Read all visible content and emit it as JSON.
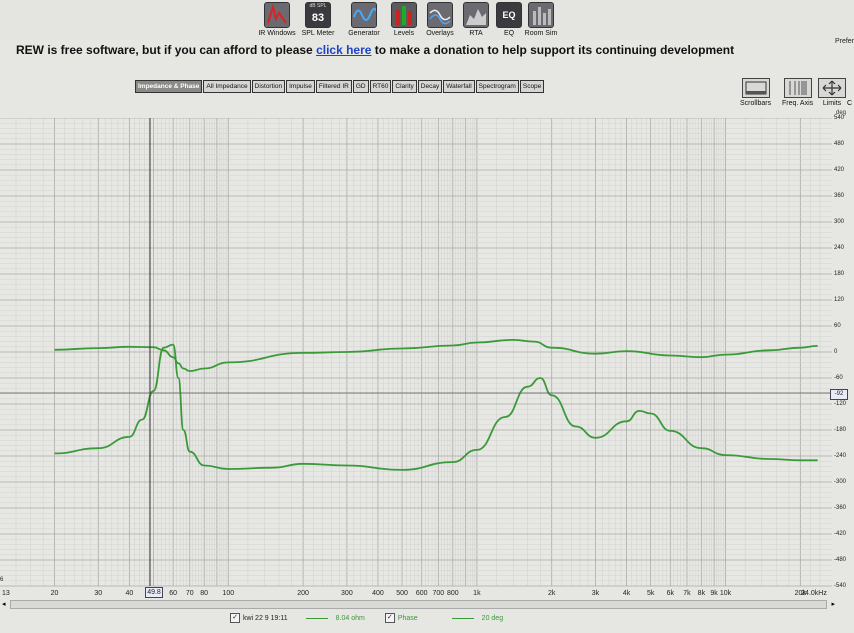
{
  "toolbar": {
    "tools": [
      {
        "label": "IR Windows",
        "icon": "ir-windows-icon"
      },
      {
        "label": "SPL Meter",
        "icon": "spl-meter-icon",
        "badge_top": "dB SPL",
        "badge_value": "83"
      },
      {
        "label": "Generator",
        "icon": "generator-icon"
      },
      {
        "label": "Levels",
        "icon": "levels-icon"
      },
      {
        "label": "Overlays",
        "icon": "overlays-icon"
      },
      {
        "label": "RTA",
        "icon": "rta-icon"
      },
      {
        "label": "EQ",
        "icon": "eq-icon",
        "badge_value": "EQ"
      },
      {
        "label": "Room Sim",
        "icon": "room-sim-icon"
      }
    ],
    "preferences_label": "Prefer"
  },
  "banner": {
    "before": "REW is free software, but if you can afford to please ",
    "link": "click here",
    "after": " to make a donation to help support its continuing development"
  },
  "tabs": [
    "Impedance & Phase",
    "All Impedance",
    "Distortion",
    "Impulse",
    "Filtered IR",
    "GD",
    "RT60",
    "Clarity",
    "Decay",
    "Waterfall",
    "Spectrogram",
    "Scope"
  ],
  "active_tab": "Impedance & Phase",
  "right_tools": {
    "scrollbars": "Scrollbars",
    "freq_axis": "Freq. Axis",
    "limits": "Limits",
    "extra": "C"
  },
  "y_unit": "deg",
  "cursor": {
    "x_readout": "49.8",
    "y_readout": "-92"
  },
  "x_axis_left_value": "13",
  "y_axis_left_fragments": [
    "6"
  ],
  "legend": {
    "name": "kwi 22 9 19:11",
    "impedance_value": "8.04 ohm",
    "phase_label": "Phase",
    "phase_value": "20 deg"
  },
  "colors": {
    "trace": "#3a9a3a",
    "grid": "#bdbdba",
    "background": "#e6e6e3",
    "link": "#1d43c6"
  },
  "chart_data": {
    "type": "line",
    "title": "",
    "xscale": "log",
    "xlim": [
      13,
      24000
    ],
    "ylim": [
      -540,
      540
    ],
    "y_unit": "deg",
    "xticks": [
      "20",
      "30",
      "40",
      "60",
      "70",
      "80",
      "100",
      "200",
      "300",
      "400",
      "500",
      "600",
      "700",
      "800",
      "1k",
      "2k",
      "3k",
      "4k",
      "5k",
      "6k",
      "7k",
      "8k",
      "9k",
      "10k",
      "20k",
      "24.0kHz"
    ],
    "yticks": [
      "540",
      "480",
      "420",
      "360",
      "300",
      "240",
      "180",
      "120",
      "60",
      "0",
      "-60",
      "-120",
      "-180",
      "-240",
      "-300",
      "-360",
      "-420",
      "-480",
      "-540"
    ],
    "series": [
      {
        "legend_ref": "impedance",
        "x": [
          20,
          30,
          40,
          45,
          50,
          55,
          60,
          63,
          66,
          70,
          80,
          100,
          150,
          200,
          300,
          500,
          800,
          1000,
          1300,
          1600,
          1800,
          2000,
          2500,
          3000,
          4000,
          4500,
          5000,
          6000,
          8000,
          10000,
          15000,
          20000,
          23500
        ],
        "y": [
          -234,
          -222,
          -196,
          -156,
          -90,
          10,
          17,
          -60,
          -180,
          -230,
          -262,
          -270,
          -267,
          -258,
          -262,
          -272,
          -254,
          -226,
          -150,
          -80,
          -60,
          -100,
          -172,
          -198,
          -160,
          -136,
          -142,
          -182,
          -222,
          -238,
          -247,
          -250,
          -250
        ]
      },
      {
        "legend_ref": "phase",
        "x": [
          20,
          30,
          40,
          50,
          55,
          60,
          63,
          66,
          70,
          80,
          100,
          200,
          300,
          500,
          800,
          1000,
          1400,
          1700,
          2000,
          3000,
          4000,
          6000,
          8000,
          10000,
          15000,
          20000,
          23500
        ],
        "y": [
          5,
          9,
          12,
          11,
          4,
          -12,
          -26,
          -38,
          -44,
          -38,
          -24,
          -2,
          0,
          8,
          15,
          22,
          28,
          24,
          10,
          -4,
          2,
          -8,
          -12,
          -6,
          4,
          10,
          14
        ]
      }
    ]
  }
}
